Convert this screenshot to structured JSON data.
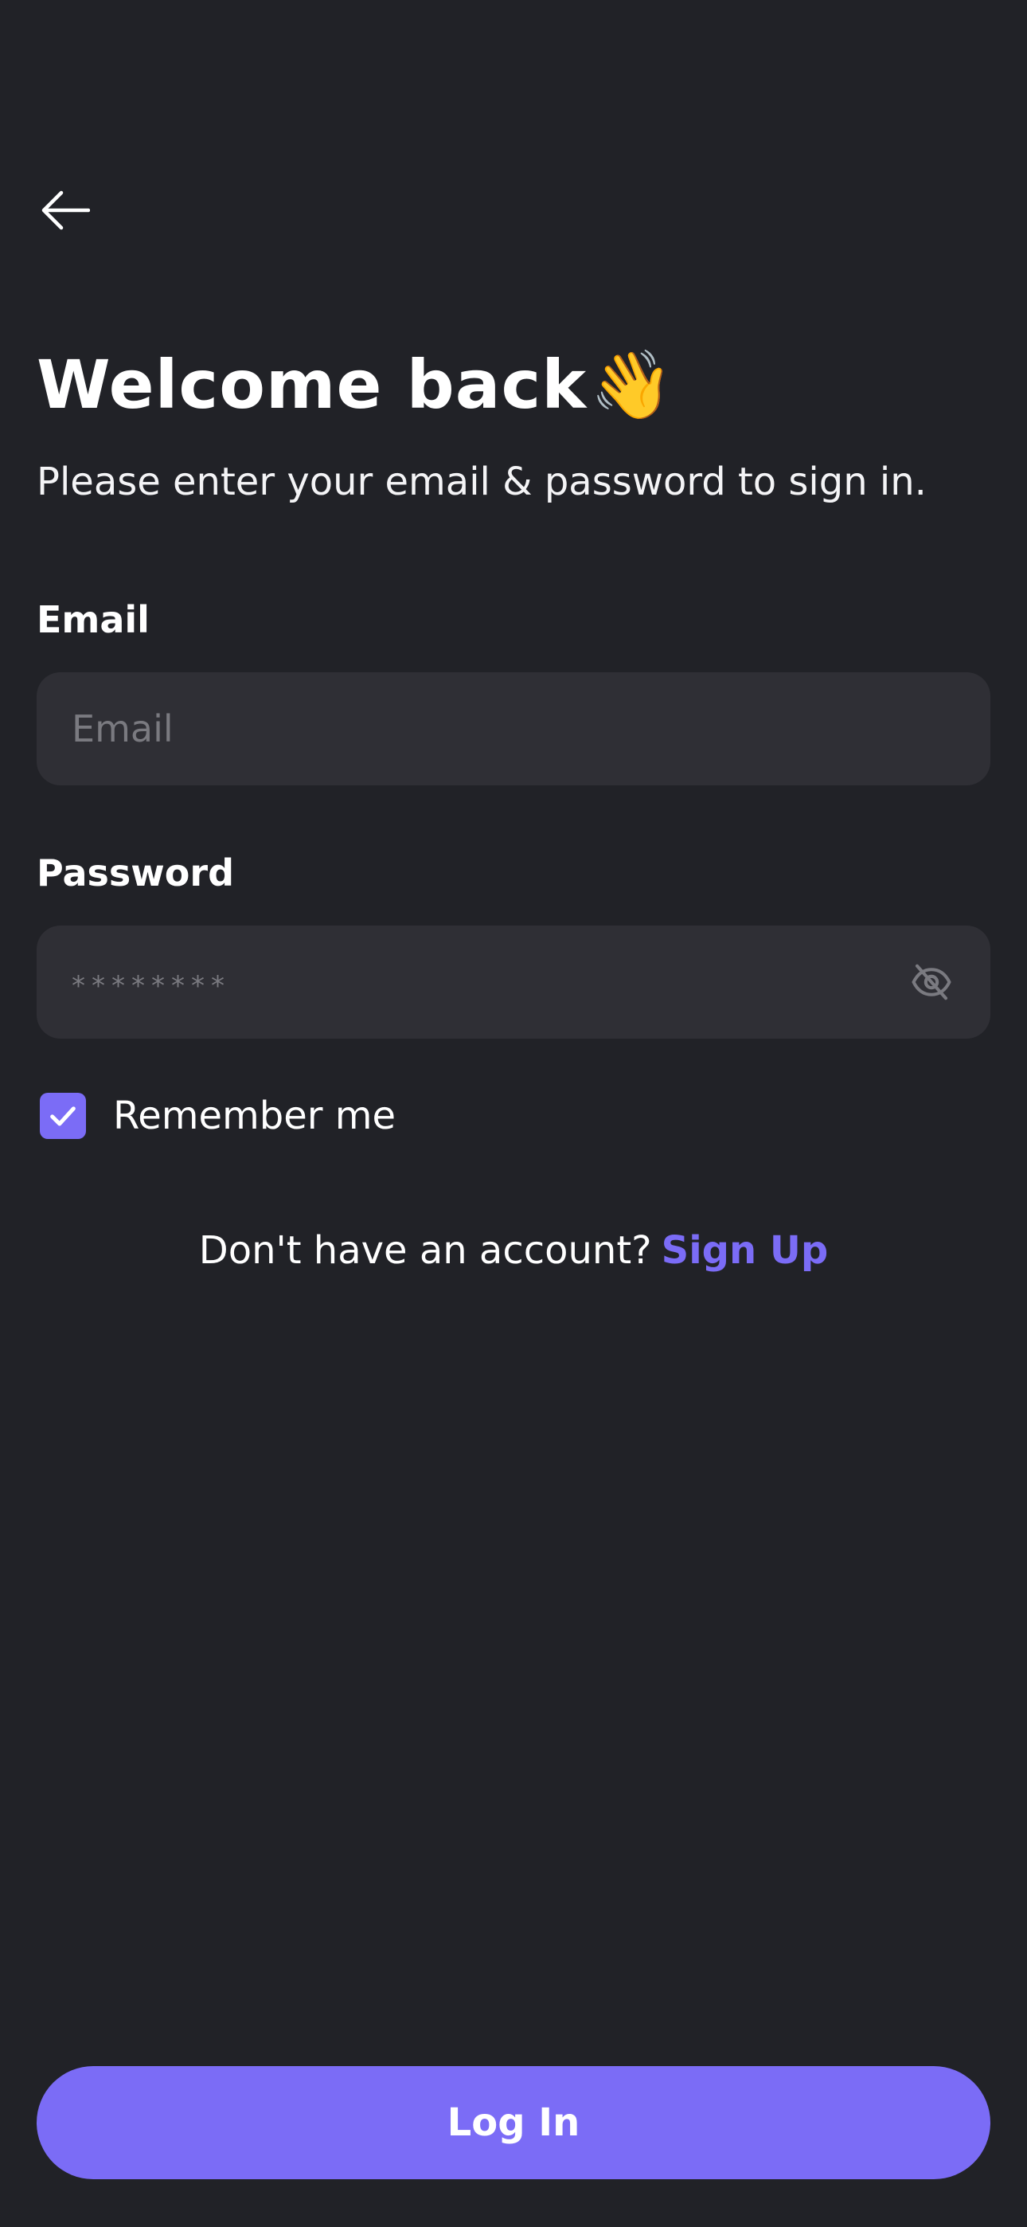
{
  "header": {
    "back_icon": "arrow-left-icon"
  },
  "intro": {
    "title": "Welcome back",
    "title_emoji": "👋",
    "subtitle": "Please enter your email & password to sign in."
  },
  "form": {
    "email": {
      "label": "Email",
      "value": "",
      "placeholder": "Email"
    },
    "password": {
      "label": "Password",
      "value": "",
      "placeholder": "********",
      "toggle_icon": "eye-off-icon"
    },
    "remember": {
      "label": "Remember me",
      "checked": true,
      "icon": "check-icon"
    }
  },
  "signup": {
    "question": "Don't have an account?",
    "link": "Sign Up"
  },
  "actions": {
    "login_label": "Log In"
  },
  "colors": {
    "background": "#212227",
    "field": "#2f2f35",
    "accent": "#7b6cf6",
    "placeholder": "#7a7a80"
  }
}
